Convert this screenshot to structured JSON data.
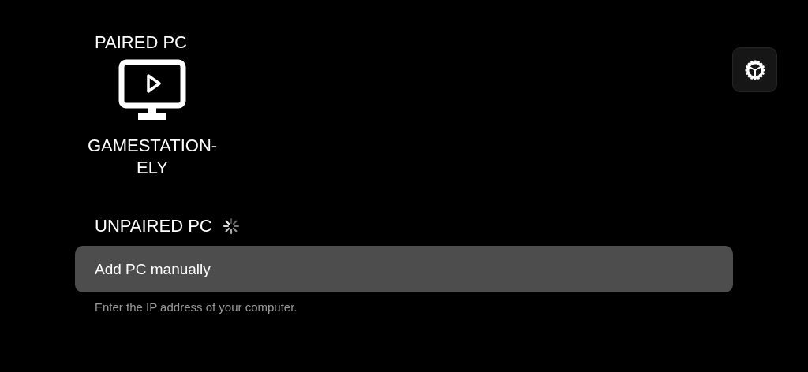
{
  "paired": {
    "heading": "PAIRED PC",
    "computers": [
      {
        "name": "GAMESTATION-ELY"
      }
    ]
  },
  "unpaired": {
    "heading": "UNPAIRED PC",
    "add_button": {
      "label": "Add PC manually"
    },
    "hint": "Enter the IP address of your computer."
  }
}
